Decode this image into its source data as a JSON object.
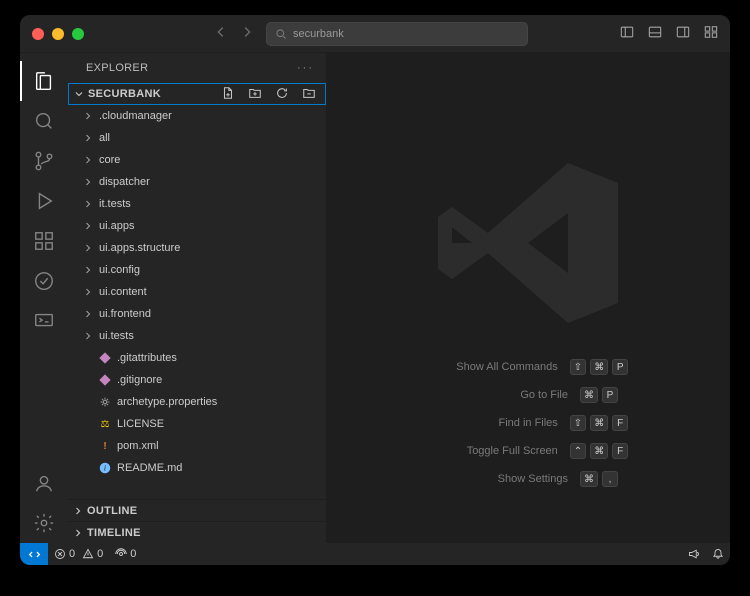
{
  "titlebar": {
    "search_text": "securbank"
  },
  "sidebar": {
    "header": "EXPLORER",
    "project": "SECURBANK",
    "folders": [
      ".cloudmanager",
      "all",
      "core",
      "dispatcher",
      "it.tests",
      "ui.apps",
      "ui.apps.structure",
      "ui.config",
      "ui.content",
      "ui.frontend",
      "ui.tests"
    ],
    "files": [
      {
        "name": ".gitattributes",
        "icon": "diamond"
      },
      {
        "name": ".gitignore",
        "icon": "diamond"
      },
      {
        "name": "archetype.properties",
        "icon": "gear"
      },
      {
        "name": "LICENSE",
        "icon": "bulb"
      },
      {
        "name": "pom.xml",
        "icon": "bang"
      },
      {
        "name": "README.md",
        "icon": "info"
      }
    ],
    "outline": "OUTLINE",
    "timeline": "TIMELINE"
  },
  "welcome": {
    "rows": [
      {
        "label": "Show All Commands",
        "keys": [
          "⇧",
          "⌘",
          "P"
        ]
      },
      {
        "label": "Go to File",
        "keys": [
          "⌘",
          "P"
        ]
      },
      {
        "label": "Find in Files",
        "keys": [
          "⇧",
          "⌘",
          "F"
        ]
      },
      {
        "label": "Toggle Full Screen",
        "keys": [
          "⌃",
          "⌘",
          "F"
        ]
      },
      {
        "label": "Show Settings",
        "keys": [
          "⌘",
          ","
        ]
      }
    ]
  },
  "status": {
    "errors": "0",
    "warnings": "0",
    "ports": "0"
  }
}
